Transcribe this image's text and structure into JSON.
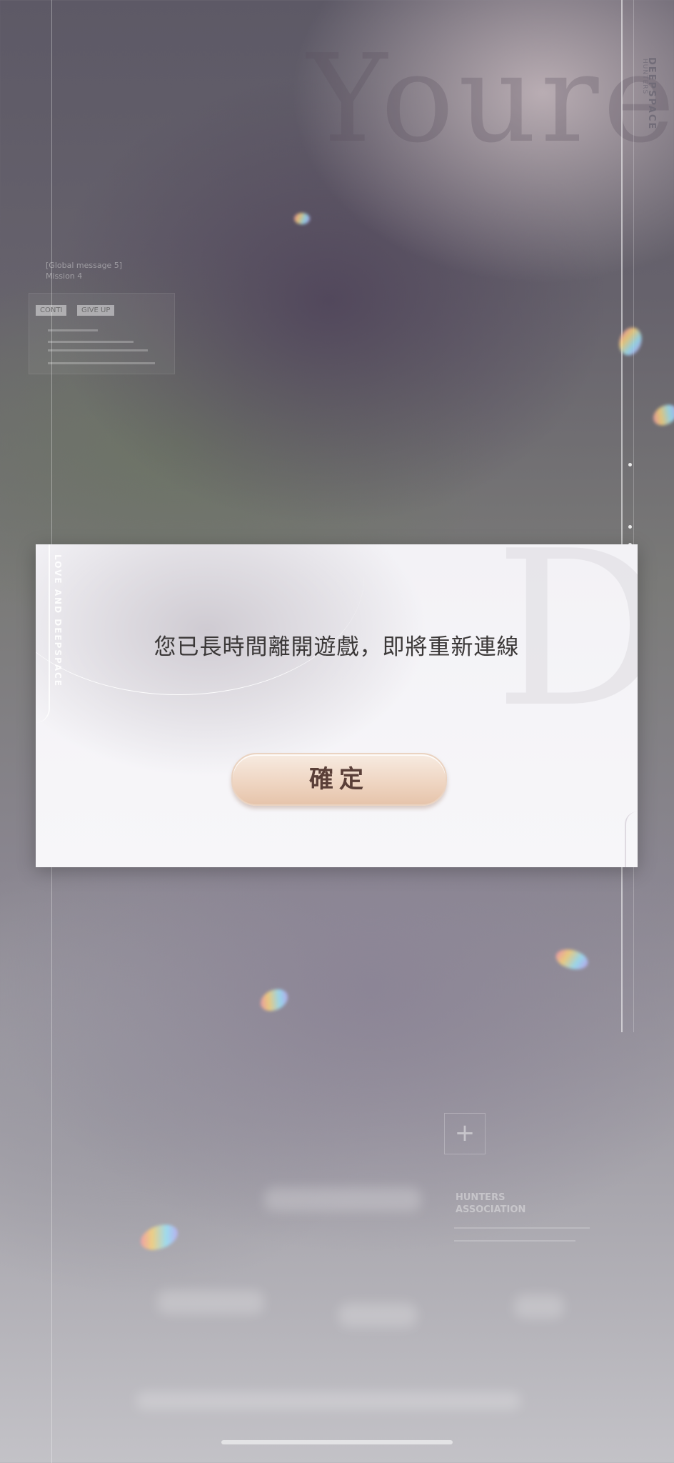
{
  "background": {
    "brand_vertical": "DEEPSPACE",
    "brand_sub": "HUNTERS",
    "mission_text": [
      "[Global message 5]",
      "Mission 4"
    ],
    "panel_buttons": [
      "CONTI",
      "GIVE UP"
    ],
    "association_title": [
      "HUNTERS",
      "ASSOCIATION"
    ],
    "add_icon": "plus-icon"
  },
  "dialog": {
    "side_text": "LOVE AND DEEPSPACE",
    "message": "您已長時間離開遊戲，即將重新連線",
    "confirm_label": "確定"
  },
  "colors": {
    "dialog_bg": "#f6f5f9",
    "message_text": "#3b3838",
    "button_fill": "#efd6c3",
    "button_text": "#5a3f38"
  }
}
